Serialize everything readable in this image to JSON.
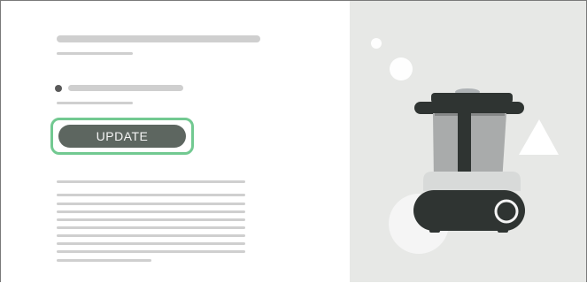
{
  "ui": {
    "update_label": "UPDATE"
  },
  "colors": {
    "left_bg": "#ffffff",
    "right_bg": "#e7e8e6",
    "placeholder": "#cfcfcf",
    "button_bg": "#5d6660",
    "button_text": "#f4f4f4",
    "focus_ring": "#72c991",
    "appliance_dark": "#2f3432",
    "appliance_metal": "#a9abab",
    "appliance_lid": "#aeb2b5"
  },
  "icons": {
    "bullet": "bullet-dot-icon",
    "appliance": "kitchen-machine-illustration"
  }
}
